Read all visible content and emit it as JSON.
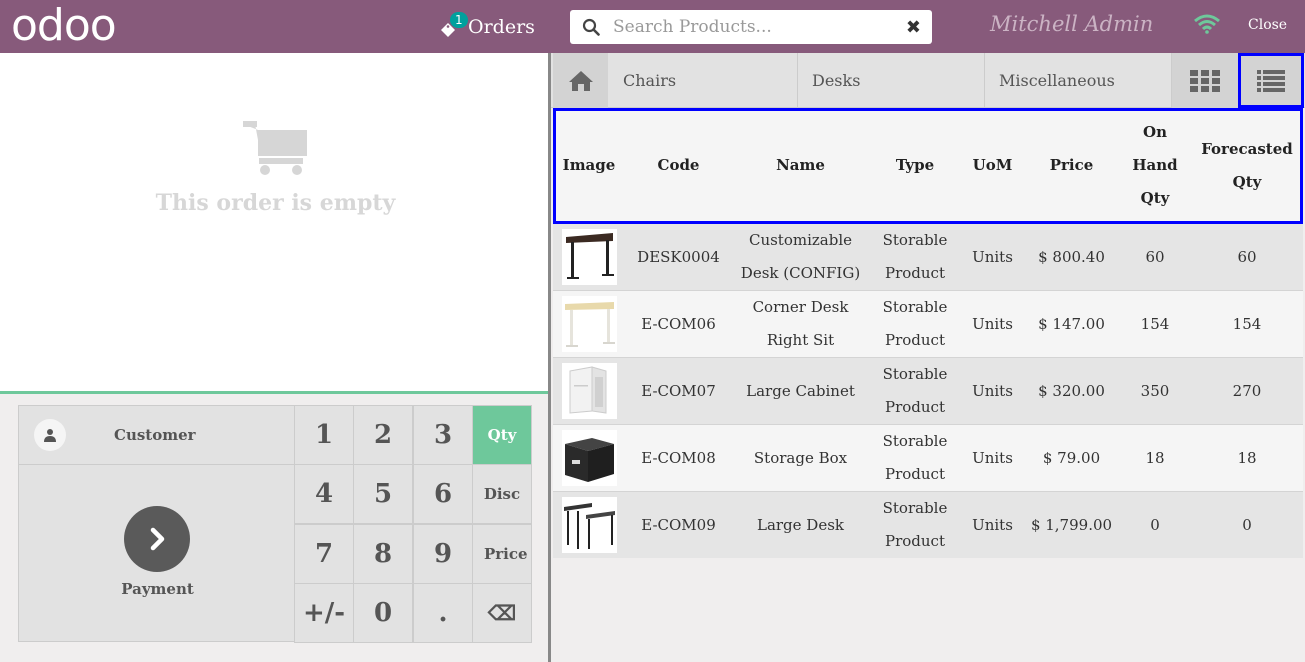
{
  "topbar": {
    "logo": "odoo",
    "orders_badge": "1",
    "orders_label": "Orders",
    "search_placeholder": "Search Products...",
    "clear_glyph": "✖",
    "cashier": "Mitchell Admin",
    "close_label": "Close"
  },
  "order": {
    "empty_text": "This order is empty"
  },
  "pad": {
    "customer_label": "Customer",
    "payment_label": "Payment",
    "keys": [
      "1",
      "2",
      "3",
      "Qty",
      "4",
      "5",
      "6",
      "Disc",
      "7",
      "8",
      "9",
      "Price",
      "+/-",
      "0",
      ".",
      "⌫"
    ],
    "active_mode": "Qty"
  },
  "categories": [
    "Chairs",
    "Desks",
    "Miscellaneous"
  ],
  "table": {
    "headers": [
      "Image",
      "Code",
      "Name",
      "Type",
      "UoM",
      "Price",
      "On Hand Qty",
      "Forecasted Qty"
    ],
    "rows": [
      {
        "image": "desk-black-thumb",
        "code": "DESK0004",
        "name": "Customizable Desk (CONFIG)",
        "type": "Storable Product",
        "uom": "Units",
        "price": "$ 800.40",
        "onhand": "60",
        "forecast": "60"
      },
      {
        "image": "corner-desk-thumb",
        "code": "E-COM06",
        "name": "Corner Desk Right Sit",
        "type": "Storable Product",
        "uom": "Units",
        "price": "$ 147.00",
        "onhand": "154",
        "forecast": "154"
      },
      {
        "image": "cabinet-thumb",
        "code": "E-COM07",
        "name": "Large Cabinet",
        "type": "Storable Product",
        "uom": "Units",
        "price": "$ 320.00",
        "onhand": "350",
        "forecast": "270"
      },
      {
        "image": "storage-box-thumb",
        "code": "E-COM08",
        "name": "Storage Box",
        "type": "Storable Product",
        "uom": "Units",
        "price": "$ 79.00",
        "onhand": "18",
        "forecast": "18"
      },
      {
        "image": "large-desk-thumb",
        "code": "E-COM09",
        "name": "Large Desk",
        "type": "Storable Product",
        "uom": "Units",
        "price": "$ 1,799.00",
        "onhand": "0",
        "forecast": "0"
      }
    ]
  },
  "colors": {
    "brand": "#875a7b",
    "accent_green": "#6ec89b",
    "highlight": "#0000ff"
  }
}
